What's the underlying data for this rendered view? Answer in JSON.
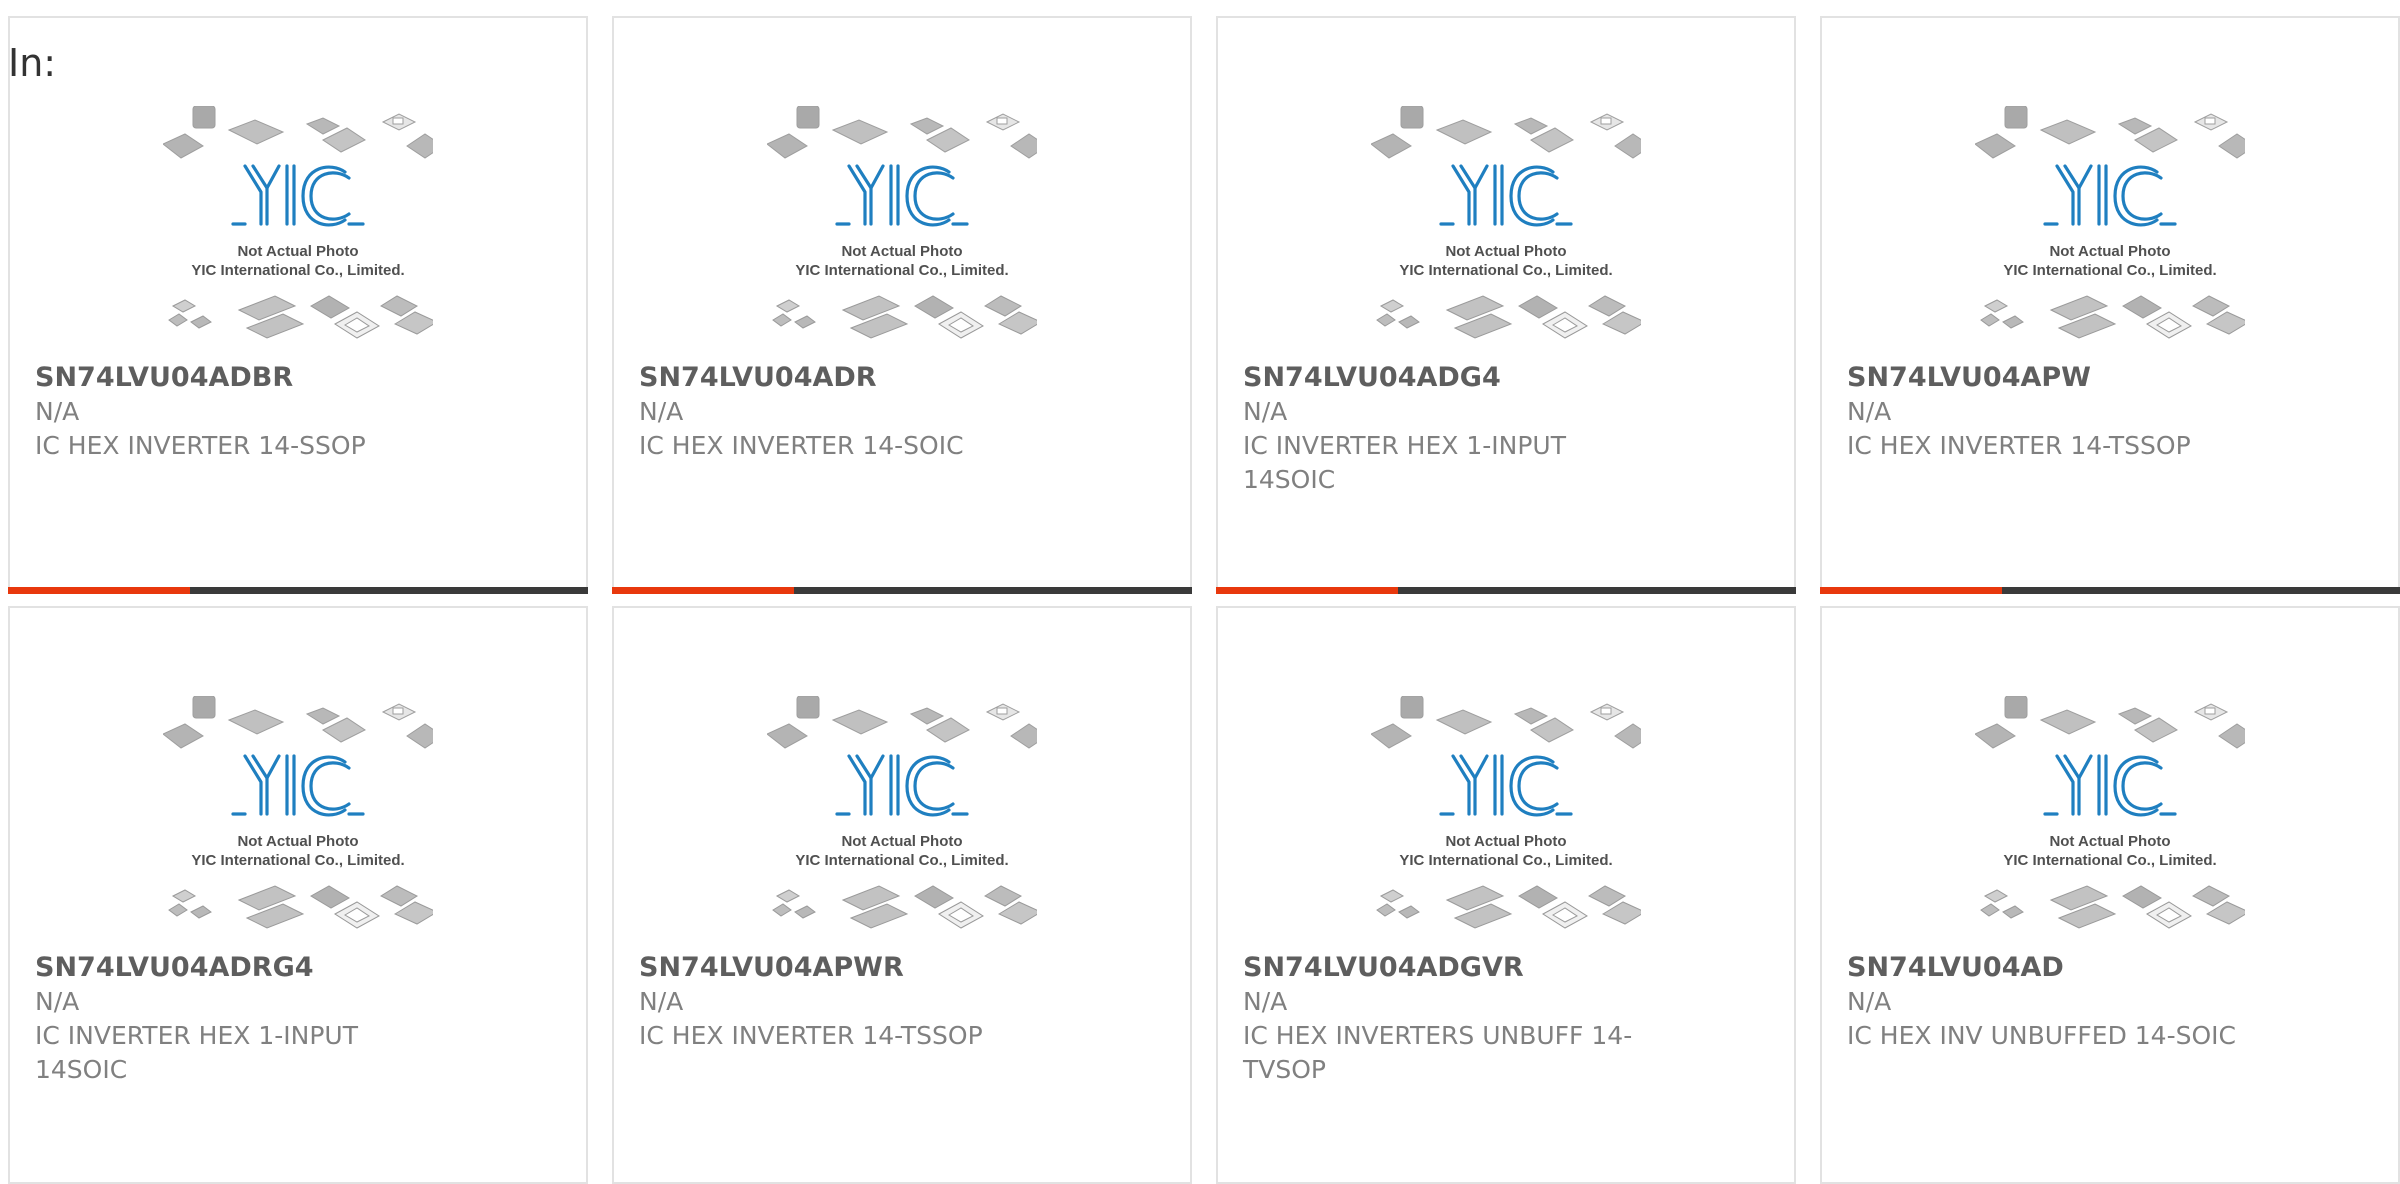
{
  "header": {
    "in_label": "In:"
  },
  "placeholder": {
    "line1": "Not Actual Photo",
    "line2": "YIC International Co., Limited.",
    "logo": "YIC",
    "logo_color": "#1f7fc0"
  },
  "colors": {
    "accent": "#e8380d",
    "bar": "#3a3a3a",
    "border": "#e2e2e2"
  },
  "products": [
    {
      "part": "SN74LVU04ADBR",
      "manufacturer": "N/A",
      "description": "IC HEX INVERTER 14-SSOP"
    },
    {
      "part": "SN74LVU04ADR",
      "manufacturer": "N/A",
      "description": "IC HEX INVERTER 14-SOIC"
    },
    {
      "part": "SN74LVU04ADG4",
      "manufacturer": "N/A",
      "description": "IC INVERTER HEX 1-INPUT 14SOIC"
    },
    {
      "part": "SN74LVU04APW",
      "manufacturer": "N/A",
      "description": "IC HEX INVERTER 14-TSSOP"
    },
    {
      "part": "SN74LVU04ADRG4",
      "manufacturer": "N/A",
      "description": "IC INVERTER HEX 1-INPUT 14SOIC"
    },
    {
      "part": "SN74LVU04APWR",
      "manufacturer": "N/A",
      "description": "IC HEX INVERTER 14-TSSOP"
    },
    {
      "part": "SN74LVU04ADGVR",
      "manufacturer": "N/A",
      "description": "IC HEX INVERTERS UNBUFF 14-TVSOP"
    },
    {
      "part": "SN74LVU04AD",
      "manufacturer": "N/A",
      "description": "IC HEX INV UNBUFFED 14-SOIC"
    }
  ]
}
